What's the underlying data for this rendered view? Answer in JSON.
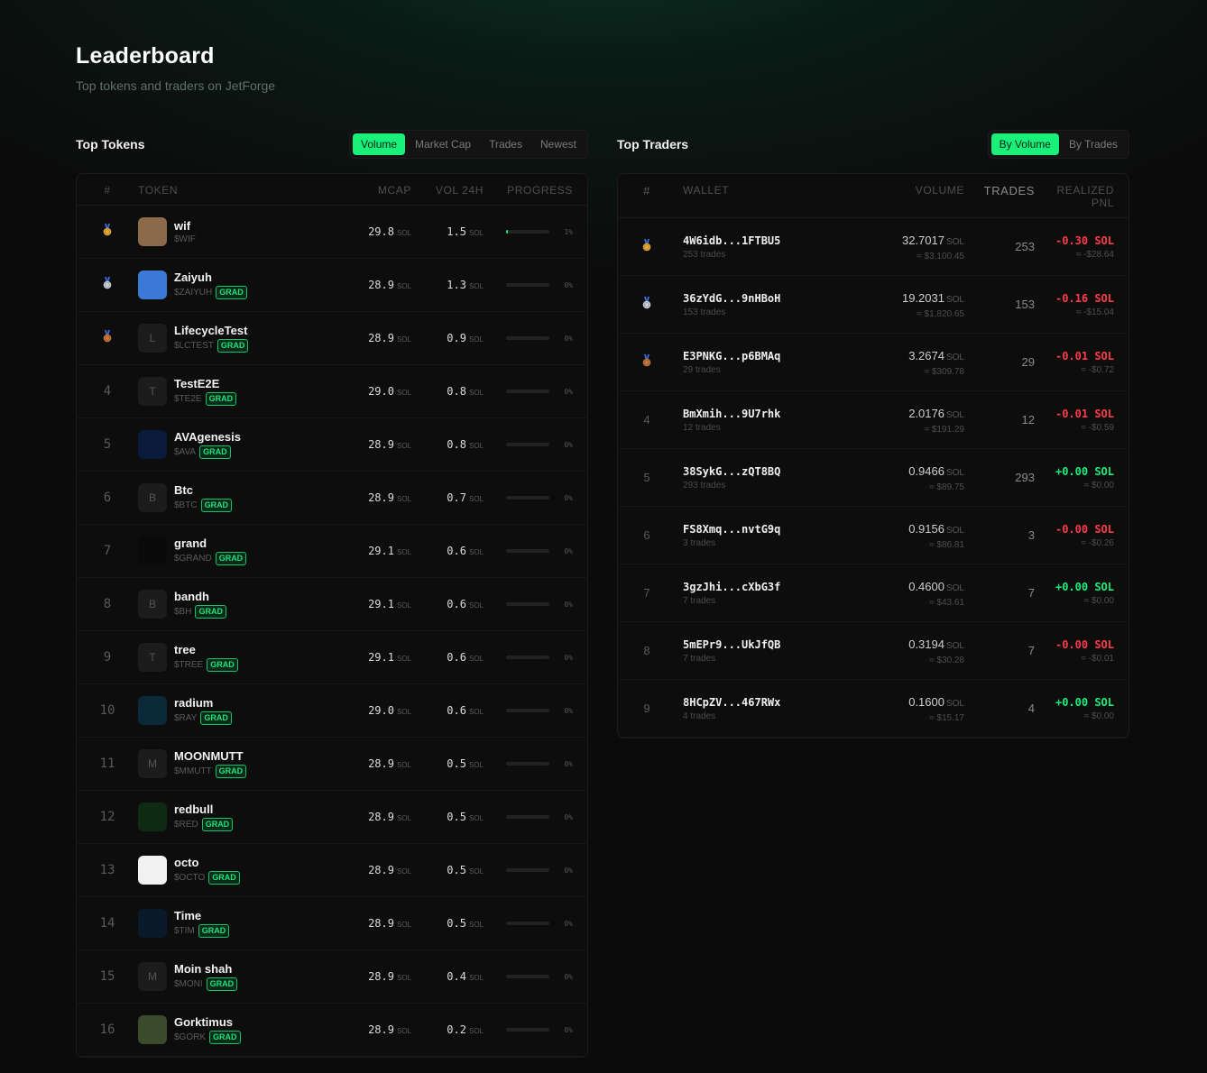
{
  "header": {
    "title": "Leaderboard",
    "subtitle": "Top tokens and traders on JetForge"
  },
  "tokens_panel": {
    "title": "Top Tokens",
    "tabs": [
      "Volume",
      "Market Cap",
      "Trades",
      "Newest"
    ],
    "active_tab": "Volume",
    "columns": {
      "rank": "#",
      "token": "TOKEN",
      "mcap": "MCAP",
      "vol": "VOL 24H",
      "progress": "PROGRESS"
    },
    "unit": "SOL",
    "rows": [
      {
        "rank": "1",
        "name": "wif",
        "symbol": "$WIF",
        "grad": "",
        "mcap": "29.8",
        "vol": "1.5",
        "progress": "1%",
        "progress_value": 1,
        "avatar": ""
      },
      {
        "rank": "2",
        "name": "Zaiyuh",
        "symbol": "$ZAIYUH",
        "grad": "GRAD",
        "mcap": "28.9",
        "vol": "1.3",
        "progress": "0%",
        "progress_value": 0,
        "avatar": ""
      },
      {
        "rank": "3",
        "name": "LifecycleTest",
        "symbol": "$LCTEST",
        "grad": "GRAD",
        "mcap": "28.9",
        "vol": "0.9",
        "progress": "0%",
        "progress_value": 0,
        "avatar": "L"
      },
      {
        "rank": "4",
        "name": "TestE2E",
        "symbol": "$TE2E",
        "grad": "GRAD",
        "mcap": "29.0",
        "vol": "0.8",
        "progress": "0%",
        "progress_value": 0,
        "avatar": "T"
      },
      {
        "rank": "5",
        "name": "AVAgenesis",
        "symbol": "$AVA",
        "grad": "GRAD",
        "mcap": "28.9",
        "vol": "0.8",
        "progress": "0%",
        "progress_value": 0,
        "avatar": ""
      },
      {
        "rank": "6",
        "name": "Btc",
        "symbol": "$BTC",
        "grad": "GRAD",
        "mcap": "28.9",
        "vol": "0.7",
        "progress": "0%",
        "progress_value": 0,
        "avatar": "B"
      },
      {
        "rank": "7",
        "name": "grand",
        "symbol": "$GRAND",
        "grad": "GRAD",
        "mcap": "29.1",
        "vol": "0.6",
        "progress": "0%",
        "progress_value": 0,
        "avatar": ""
      },
      {
        "rank": "8",
        "name": "bandh",
        "symbol": "$BH",
        "grad": "GRAD",
        "mcap": "29.1",
        "vol": "0.6",
        "progress": "0%",
        "progress_value": 0,
        "avatar": "B"
      },
      {
        "rank": "9",
        "name": "tree",
        "symbol": "$TREE",
        "grad": "GRAD",
        "mcap": "29.1",
        "vol": "0.6",
        "progress": "0%",
        "progress_value": 0,
        "avatar": "T"
      },
      {
        "rank": "10",
        "name": "radium",
        "symbol": "$RAY",
        "grad": "GRAD",
        "mcap": "29.0",
        "vol": "0.6",
        "progress": "0%",
        "progress_value": 0,
        "avatar": ""
      },
      {
        "rank": "11",
        "name": "MOONMUTT",
        "symbol": "$MMUTT",
        "grad": "GRAD",
        "mcap": "28.9",
        "vol": "0.5",
        "progress": "0%",
        "progress_value": 0,
        "avatar": "M"
      },
      {
        "rank": "12",
        "name": "redbull",
        "symbol": "$RED",
        "grad": "GRAD",
        "mcap": "28.9",
        "vol": "0.5",
        "progress": "0%",
        "progress_value": 0,
        "avatar": ""
      },
      {
        "rank": "13",
        "name": "octo",
        "symbol": "$OCTO",
        "grad": "GRAD",
        "mcap": "28.9",
        "vol": "0.5",
        "progress": "0%",
        "progress_value": 0,
        "avatar": ""
      },
      {
        "rank": "14",
        "name": "Time",
        "symbol": "$TIM",
        "grad": "GRAD",
        "mcap": "28.9",
        "vol": "0.5",
        "progress": "0%",
        "progress_value": 0,
        "avatar": ""
      },
      {
        "rank": "15",
        "name": "Moin shah",
        "symbol": "$MONI",
        "grad": "GRAD",
        "mcap": "28.9",
        "vol": "0.4",
        "progress": "0%",
        "progress_value": 0,
        "avatar": "M"
      },
      {
        "rank": "16",
        "name": "Gorktimus",
        "symbol": "$GORK",
        "grad": "GRAD",
        "mcap": "28.9",
        "vol": "0.2",
        "progress": "0%",
        "progress_value": 0,
        "avatar": ""
      }
    ]
  },
  "traders_panel": {
    "title": "Top Traders",
    "tabs": [
      "By Volume",
      "By Trades"
    ],
    "active_tab": "By Volume",
    "columns": {
      "rank": "#",
      "wallet": "WALLET",
      "volume": "VOLUME",
      "trades": "TRADES",
      "pnl_line1": "REALIZED",
      "pnl_line2": "PNL"
    },
    "unit": "SOL",
    "rows": [
      {
        "rank": "1",
        "wallet": "4W6idb...1FTBU5",
        "trades_sub": "253 trades",
        "volume": "32.7017",
        "usd": "≈ $3,100.45",
        "trades": "253",
        "pnl": "-0.30 SOL",
        "pnl_usd": "≈ -$28.64",
        "pnl_sign": "neg"
      },
      {
        "rank": "2",
        "wallet": "36zYdG...9nHBoH",
        "trades_sub": "153 trades",
        "volume": "19.2031",
        "usd": "≈ $1,820.65",
        "trades": "153",
        "pnl": "-0.16 SOL",
        "pnl_usd": "≈ -$15.04",
        "pnl_sign": "neg"
      },
      {
        "rank": "3",
        "wallet": "E3PNKG...p6BMAq",
        "trades_sub": "29 trades",
        "volume": "3.2674",
        "usd": "≈ $309.78",
        "trades": "29",
        "pnl": "-0.01 SOL",
        "pnl_usd": "≈ -$0.72",
        "pnl_sign": "neg"
      },
      {
        "rank": "4",
        "wallet": "BmXmih...9U7rhk",
        "trades_sub": "12 trades",
        "volume": "2.0176",
        "usd": "≈ $191.29",
        "trades": "12",
        "pnl": "-0.01 SOL",
        "pnl_usd": "≈ -$0.59",
        "pnl_sign": "neg"
      },
      {
        "rank": "5",
        "wallet": "38SykG...zQT8BQ",
        "trades_sub": "293 trades",
        "volume": "0.9466",
        "usd": "≈ $89.75",
        "trades": "293",
        "pnl": "+0.00 SOL",
        "pnl_usd": "≈ $0.00",
        "pnl_sign": "pos"
      },
      {
        "rank": "6",
        "wallet": "FS8Xmq...nvtG9q",
        "trades_sub": "3 trades",
        "volume": "0.9156",
        "usd": "≈ $86.81",
        "trades": "3",
        "pnl": "-0.00 SOL",
        "pnl_usd": "≈ -$0.26",
        "pnl_sign": "neg"
      },
      {
        "rank": "7",
        "wallet": "3gzJhi...cXbG3f",
        "trades_sub": "7 trades",
        "volume": "0.4600",
        "usd": "≈ $43.61",
        "trades": "7",
        "pnl": "+0.00 SOL",
        "pnl_usd": "≈ $0.00",
        "pnl_sign": "pos"
      },
      {
        "rank": "8",
        "wallet": "5mEPr9...UkJfQB",
        "trades_sub": "7 trades",
        "volume": "0.3194",
        "usd": "≈ $30.28",
        "trades": "7",
        "pnl": "-0.00 SOL",
        "pnl_usd": "≈ -$0.01",
        "pnl_sign": "neg"
      },
      {
        "rank": "9",
        "wallet": "8HCpZV...467RWx",
        "trades_sub": "4 trades",
        "volume": "0.1600",
        "usd": "≈ $15.17",
        "trades": "4",
        "pnl": "+0.00 SOL",
        "pnl_usd": "≈ $0.00",
        "pnl_sign": "pos"
      }
    ]
  },
  "colors": {
    "accent": "#19f07a",
    "negative": "#ff3b4a",
    "gold": "#e9a93a",
    "silver": "#c9cfd8",
    "bronze": "#c8763c"
  }
}
